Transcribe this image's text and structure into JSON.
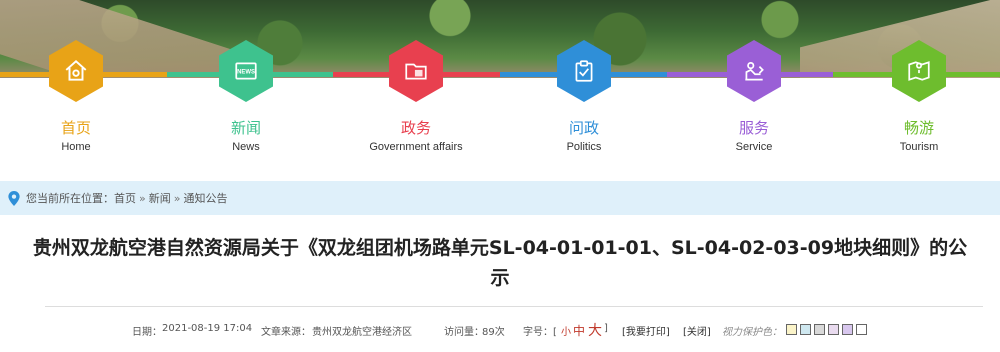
{
  "nav": {
    "items": [
      {
        "cn": "首页",
        "en": "Home",
        "color": "#e8a317",
        "icon": "home-icon"
      },
      {
        "cn": "新闻",
        "en": "News",
        "color": "#3ec28e",
        "icon": "news-icon"
      },
      {
        "cn": "政务",
        "en": "Government affairs",
        "color": "#e8404f",
        "icon": "folder-icon"
      },
      {
        "cn": "问政",
        "en": "Politics",
        "color": "#2f8fd8",
        "icon": "clipboard-icon"
      },
      {
        "cn": "服务",
        "en": "Service",
        "color": "#9a5fd6",
        "icon": "service-icon"
      },
      {
        "cn": "畅游",
        "en": "Tourism",
        "color": "#6ebd2e",
        "icon": "map-icon"
      }
    ]
  },
  "breadcrumb": {
    "prefix": "您当前所在位置：",
    "items": [
      "首页",
      "新闻",
      "通知公告"
    ],
    "separator": "»"
  },
  "article": {
    "title_line1": "贵州双龙航空港自然资源局关于《双龙组团机场路单元SL-04-01-01-01、SL-04-02-03-09地块细则》的公",
    "title_line2": "示",
    "date_label": "日期：",
    "date": "2021-08-19 17:04",
    "source_label": "文章来源：",
    "source": "贵州双龙航空港经济区",
    "views_label": "访问量：",
    "views": "89次",
    "fontsize_label": "字号：[",
    "size_small": "小",
    "size_medium": "中",
    "size_large": "大",
    "fontsize_end": "]",
    "print": "[我要打印]",
    "close": "[关闭]",
    "eye_label": "视力保护色：",
    "eye_colors": [
      "#fbf4c9",
      "#cfe8f0",
      "#d9d9d9",
      "#e9dbef",
      "#d8c7ee",
      "#ffffff"
    ]
  }
}
